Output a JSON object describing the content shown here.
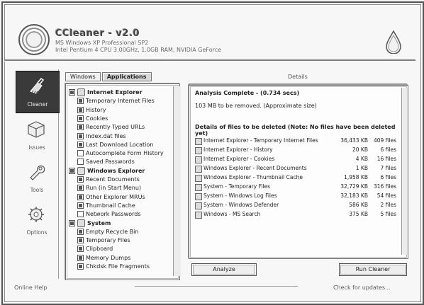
{
  "app": {
    "title": "CCleaner - v2.0",
    "subtitle": "MS Windows XP Professional SP2",
    "subtitle2": "Intel Pentium 4 CPU 3.00GHz, 1.0GB RAM, NVIDIA GeForce"
  },
  "nav": [
    {
      "label": "Cleaner",
      "icon": "broom-icon",
      "active": true
    },
    {
      "label": "Issues",
      "icon": "registry-cube-icon",
      "active": false
    },
    {
      "label": "Tools",
      "icon": "wrench-icon",
      "active": false
    },
    {
      "label": "Options",
      "icon": "gear-icon",
      "active": false
    }
  ],
  "tree": {
    "tabs": [
      "Windows",
      "Applications"
    ],
    "rows": [
      {
        "label": "Internet Explorer",
        "group": true,
        "checked": true
      },
      {
        "label": "Temporary Internet Files",
        "group": false,
        "checked": true
      },
      {
        "label": "History",
        "group": false,
        "checked": true
      },
      {
        "label": "Cookies",
        "group": false,
        "checked": true
      },
      {
        "label": "Recently Typed URLs",
        "group": false,
        "checked": true
      },
      {
        "label": "Index.dat files",
        "group": false,
        "checked": true
      },
      {
        "label": "Last Download Location",
        "group": false,
        "checked": true
      },
      {
        "label": "Autocomplete Form History",
        "group": false,
        "checked": false
      },
      {
        "label": "Saved Passwords",
        "group": false,
        "checked": false
      },
      {
        "label": "Windows Explorer",
        "group": true,
        "checked": true
      },
      {
        "label": "Recent Documents",
        "group": false,
        "checked": true
      },
      {
        "label": "Run (in Start Menu)",
        "group": false,
        "checked": true
      },
      {
        "label": "Other Explorer MRUs",
        "group": false,
        "checked": true
      },
      {
        "label": "Thumbnail Cache",
        "group": false,
        "checked": true
      },
      {
        "label": "Network Passwords",
        "group": false,
        "checked": false
      },
      {
        "label": "System",
        "group": true,
        "checked": true
      },
      {
        "label": "Empty Recycle Bin",
        "group": false,
        "checked": true
      },
      {
        "label": "Temporary Files",
        "group": false,
        "checked": true
      },
      {
        "label": "Clipboard",
        "group": false,
        "checked": true
      },
      {
        "label": "Memory Dumps",
        "group": false,
        "checked": true
      },
      {
        "label": "Chkdsk File Fragments",
        "group": false,
        "checked": true
      }
    ]
  },
  "results": {
    "header": "Details",
    "title": "Analysis Complete - (0.734 secs)",
    "subtitle": "103 MB to be removed. (Approximate size)",
    "section": "Details of files to be deleted (Note: No files have been deleted yet)",
    "rows": [
      {
        "name": "Internet Explorer - Temporary Internet Files",
        "size": "36,433 KB",
        "files": "409 files"
      },
      {
        "name": "Internet Explorer - History",
        "size": "20 KB",
        "files": "6 files"
      },
      {
        "name": "Internet Explorer - Cookies",
        "size": "4 KB",
        "files": "16 files"
      },
      {
        "name": "Windows Explorer - Recent Documents",
        "size": "1 KB",
        "files": "7 files"
      },
      {
        "name": "Windows Explorer - Thumbnail Cache",
        "size": "1,958 KB",
        "files": "6 files"
      },
      {
        "name": "System - Temporary Files",
        "size": "32,729 KB",
        "files": "316 files"
      },
      {
        "name": "System - Windows Log Files",
        "size": "32,183 KB",
        "files": "54 files"
      },
      {
        "name": "System - Windows Defender",
        "size": "586 KB",
        "files": "2 files"
      },
      {
        "name": "Windows - MS Search",
        "size": "375 KB",
        "files": "5 files"
      }
    ]
  },
  "buttons": {
    "analyze": "Analyze",
    "run": "Run Cleaner"
  },
  "footer": {
    "left": "Online Help",
    "right": "Check for updates..."
  }
}
